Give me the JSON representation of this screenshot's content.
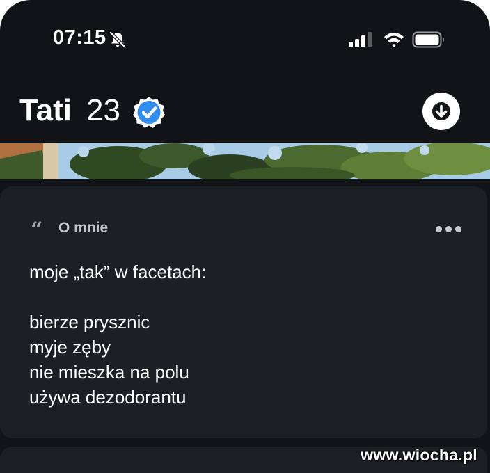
{
  "status_bar": {
    "time": "07:15",
    "bell_icon": "bell-slash-icon",
    "signal_icon": "cellular-signal-icon",
    "wifi_icon": "wifi-icon",
    "battery_icon": "battery-icon"
  },
  "profile": {
    "name": "Tati",
    "age": "23",
    "verified_icon": "verified-badge-icon",
    "badge_color": "#2f8ef0",
    "download_icon": "arrow-down-circle-icon"
  },
  "about": {
    "quote_glyph": "“",
    "title": "O mnie",
    "more_icon": "ellipsis-icon",
    "bio_lines": [
      "moje „tak” w facetach:",
      "",
      "bierze prysznic",
      "myje zęby",
      "nie mieszka na polu",
      "używa dezodorantu"
    ]
  },
  "watermark": "www.wiocha.pl",
  "colors": {
    "background": "#111317",
    "card": "#1c1f24",
    "text": "#ffffff",
    "muted_text": "#c2c6cd"
  }
}
